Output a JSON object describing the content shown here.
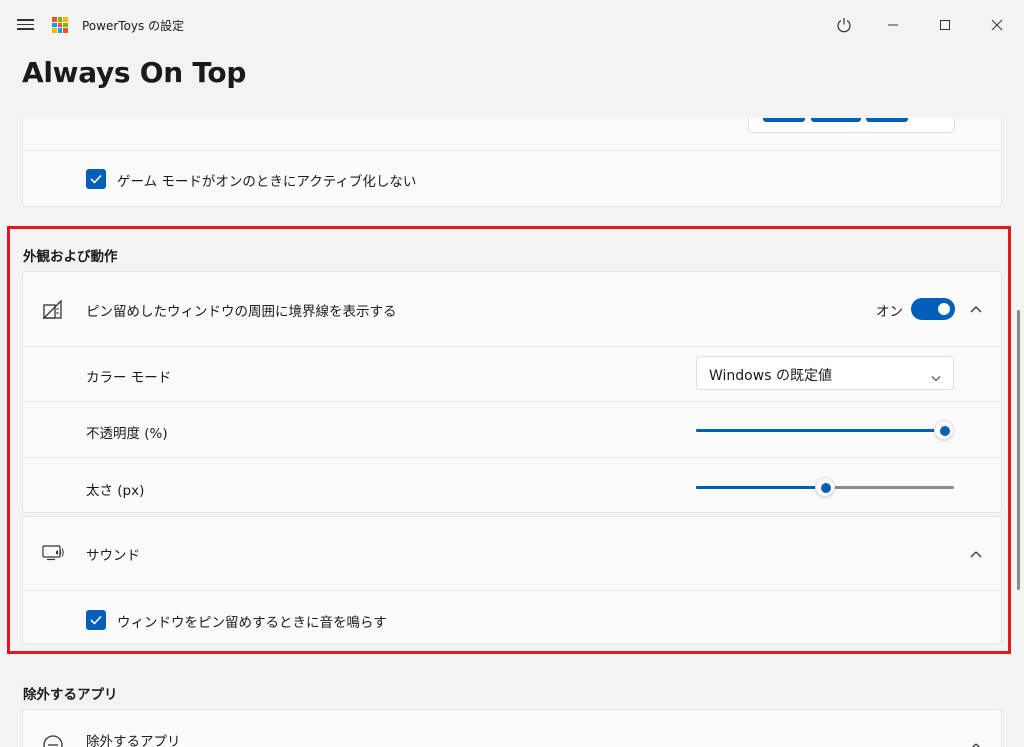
{
  "window": {
    "title": "PowerToys の設定"
  },
  "page": {
    "title": "Always On Top"
  },
  "game_mode": {
    "label": "ゲーム モードがオンのときにアクティブ化しない",
    "checked": true
  },
  "appearance": {
    "section_title": "外観および動作",
    "border": {
      "label": "ピン留めしたウィンドウの周囲に境界線を表示する",
      "toggle_label": "オン",
      "enabled": true
    },
    "color_mode": {
      "label": "カラー モード",
      "value": "Windows の既定値"
    },
    "opacity": {
      "label": "不透明度 (%)",
      "value": 100
    },
    "thickness": {
      "label": "太さ (px)",
      "value_fraction": 0.5
    },
    "sound": {
      "label": "サウンド",
      "checkbox_label": "ウィンドウをピン留めするときに音を鳴らす",
      "checked": true
    }
  },
  "excluded": {
    "section_title": "除外するアプリ",
    "card_label": "除外するアプリ"
  },
  "colors": {
    "accent": "#005fb8",
    "highlight": "#e3161b"
  }
}
